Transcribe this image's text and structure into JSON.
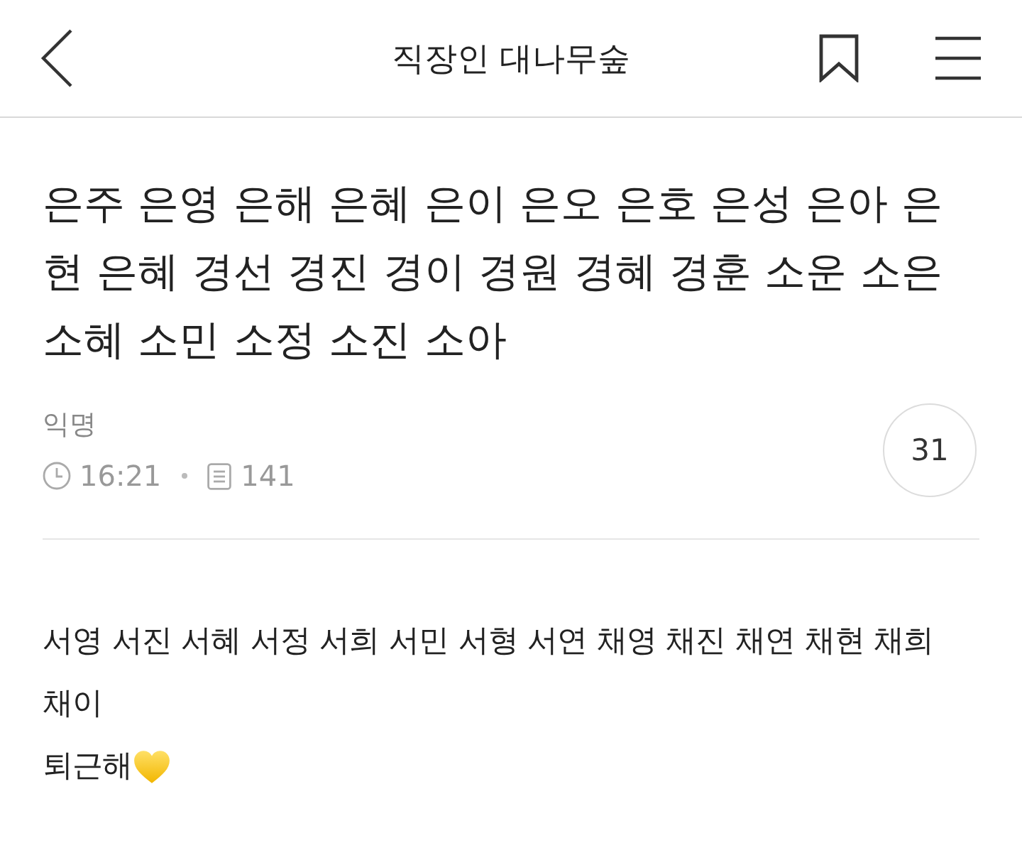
{
  "header": {
    "title": "직장인 대나무숲"
  },
  "post": {
    "title": "은주 은영 은해 은혜 은이 은오 은호 은성 은아 은현 은혜 경선 경진 경이 경원 경혜 경훈 소운 소은 소혜 소민 소정 소진 소아",
    "author": "익명",
    "time": "16:21",
    "views": "141",
    "comment_count": "31"
  },
  "body": {
    "paragraphs": [
      {
        "text": "서영 서진 서혜 서정 서희 서민 서형 서연 채영 채진 채연 채현 채희 채이",
        "heart": false
      },
      {
        "text": "퇴근해",
        "heart": true
      }
    ]
  }
}
